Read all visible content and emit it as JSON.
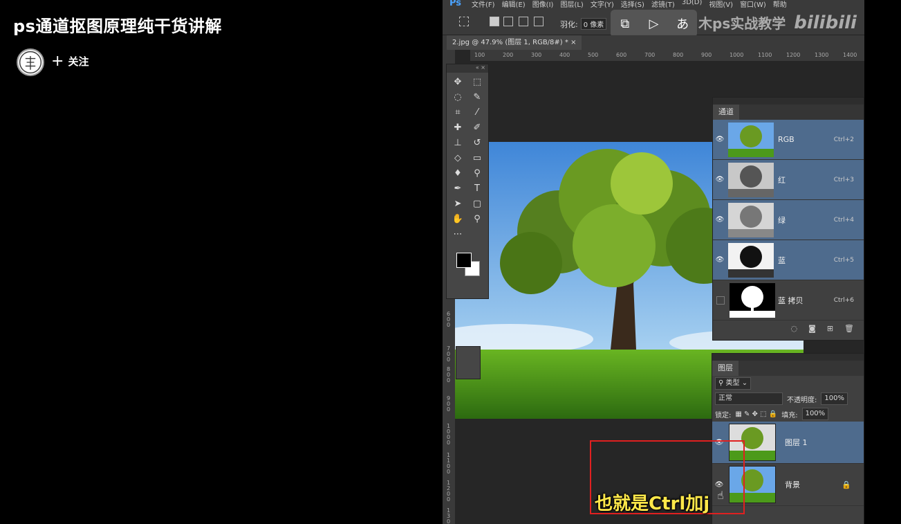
{
  "video_title": "ps通道抠图原理纯干货讲解",
  "follow_label": "关注",
  "app": {
    "logo": "Ps",
    "menu": [
      "文件(F)",
      "编辑(E)",
      "图像(I)",
      "图层(L)",
      "文字(Y)",
      "选择(S)",
      "滤镜(T)",
      "3D(D)",
      "视图(V)",
      "窗口(W)",
      "帮助"
    ],
    "feather_label": "羽化:",
    "feather_value": "0 像素",
    "doc_tab": "2.jpg @ 47.9% (图层 1, RGB/8#) *",
    "ruler_top": [
      "100",
      "200",
      "300",
      "400",
      "500",
      "600",
      "700",
      "800",
      "900",
      "1000",
      "1100",
      "1200",
      "1300",
      "1400"
    ],
    "ruler_left": [
      "600",
      "700",
      "800",
      "900",
      "1000",
      "1100",
      "1200",
      "1300"
    ]
  },
  "watermark": {
    "text": "木ps实战教学",
    "logo": "bilibili"
  },
  "channels_panel": {
    "tab": "通道",
    "rows": [
      {
        "name": "RGB",
        "shortcut": "Ctrl+2",
        "selected": true,
        "visible": true
      },
      {
        "name": "红",
        "shortcut": "Ctrl+3",
        "selected": true,
        "visible": true
      },
      {
        "name": "绿",
        "shortcut": "Ctrl+4",
        "selected": true,
        "visible": true
      },
      {
        "name": "蓝",
        "shortcut": "Ctrl+5",
        "selected": true,
        "visible": true
      },
      {
        "name": "蓝 拷贝",
        "shortcut": "Ctrl+6",
        "selected": false,
        "visible": false
      }
    ]
  },
  "layers_panel": {
    "tab": "图层",
    "filter_label": "类型",
    "blend_mode": "正常",
    "opacity_label": "不透明度:",
    "opacity_value": "100%",
    "lock_label": "锁定:",
    "fill_label": "填充:",
    "fill_value": "100%",
    "layers": [
      {
        "name": "图层 1",
        "selected": true
      },
      {
        "name": "背景",
        "selected": false,
        "locked": true
      }
    ]
  },
  "subtitle": "也就是Ctrl加j",
  "colors": {
    "selection": "#4e6b8d",
    "highlight_box": "#e02020",
    "subtitle": "#ffe84a"
  }
}
